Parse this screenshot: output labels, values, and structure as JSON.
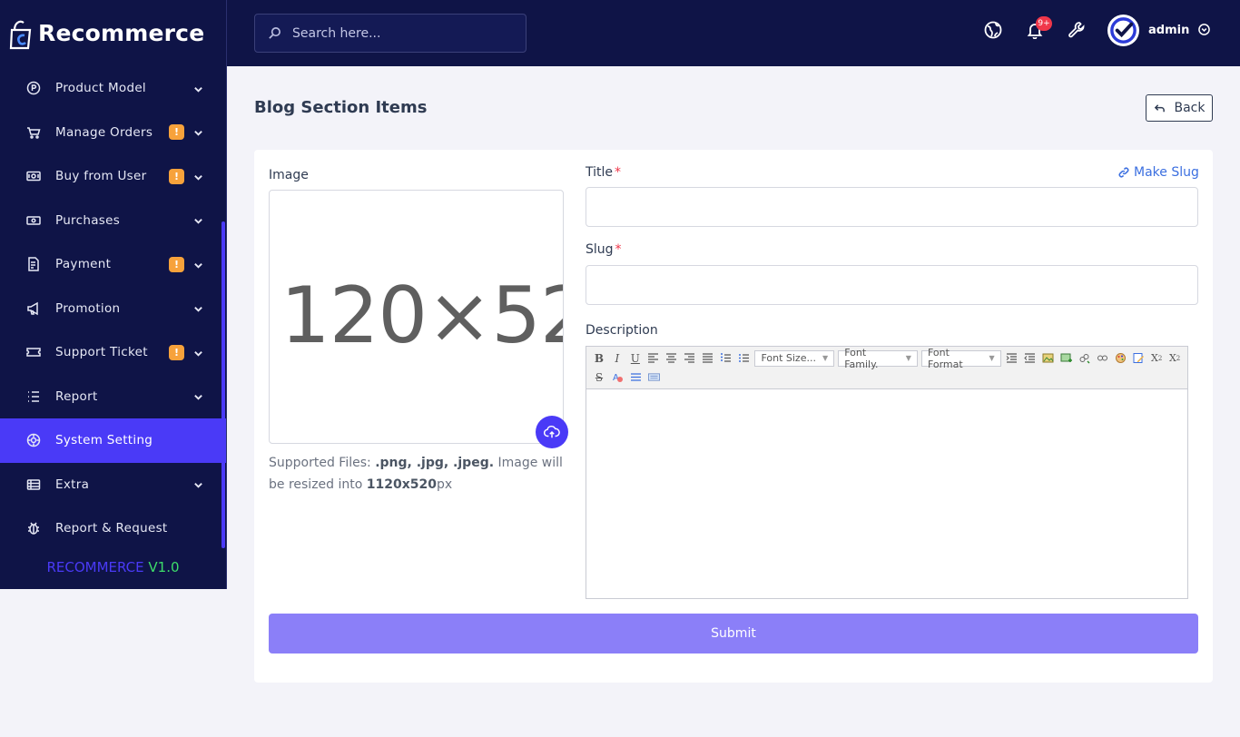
{
  "brand": {
    "name": "Recommerce"
  },
  "sidebar": {
    "items": [
      {
        "label": "Product Model",
        "badge": "",
        "icon": "product-icon"
      },
      {
        "label": "Manage Orders",
        "badge": "!",
        "icon": "cart-icon"
      },
      {
        "label": "Buy from User",
        "badge": "!",
        "icon": "cash-icon"
      },
      {
        "label": "Purchases",
        "badge": "",
        "icon": "money-icon"
      },
      {
        "label": "Payment",
        "badge": "!",
        "icon": "receipt-icon"
      },
      {
        "label": "Promotion",
        "badge": "",
        "icon": "megaphone-icon"
      },
      {
        "label": "Support Ticket",
        "badge": "!",
        "icon": "ticket-icon"
      },
      {
        "label": "Report",
        "badge": "",
        "icon": "list-icon"
      },
      {
        "label": "System Setting",
        "badge": "",
        "icon": "settings-icon",
        "active": true
      },
      {
        "label": "Extra",
        "badge": "",
        "icon": "grid-icon"
      },
      {
        "label": "Report & Request",
        "badge": "",
        "icon": "bug-icon"
      }
    ],
    "version_brand": "RECOMMERCE",
    "version_num": "V1.0"
  },
  "topbar": {
    "search_placeholder": "Search here...",
    "notifications_count": "9+",
    "user_name": "admin"
  },
  "page": {
    "title": "Blog Section Items",
    "back_label": "Back"
  },
  "form": {
    "image_label": "Image",
    "image_placeholder": "120×52",
    "support_prefix": "Supported Files: ",
    "support_types": ".png, .jpg, .jpeg.",
    "support_mid": " Image will be resized into ",
    "support_size": "1120x520",
    "support_unit": "px",
    "title_label": "Title",
    "make_slug_label": "Make Slug",
    "slug_label": "Slug",
    "description_label": "Description",
    "required_mark": "*",
    "editor": {
      "font_size": "Font Size...",
      "font_family": "Font Family.",
      "font_format": "Font Format"
    },
    "submit_label": "Submit"
  },
  "colors": {
    "sidebar_bg": "#0f1447",
    "accent": "#4a3af7",
    "badge": "#f7a23b",
    "submit": "#8b7ff8",
    "version_green": "#3ddc6a"
  }
}
